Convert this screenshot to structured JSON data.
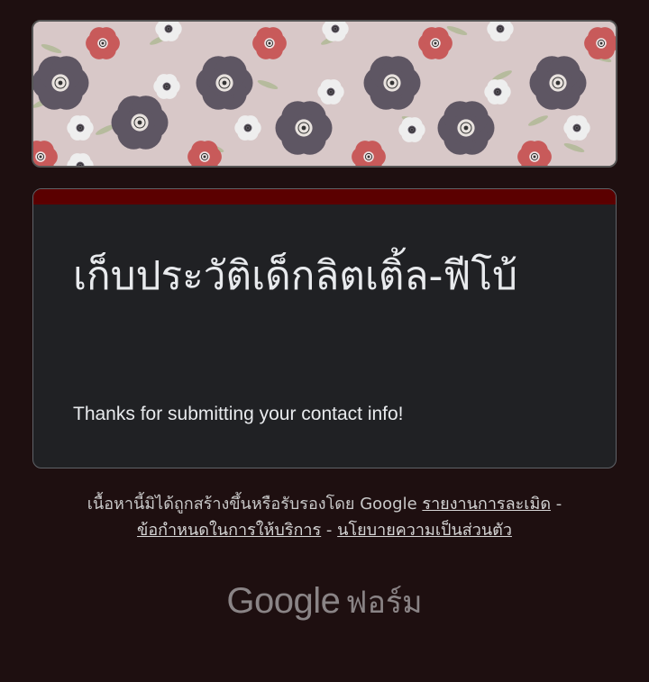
{
  "banner": {
    "background_color": "#d8c8c8",
    "flower_colors": [
      "#5e5663",
      "#c85a5a",
      "#eeeeee"
    ]
  },
  "card": {
    "accent_color": "#5b0000",
    "title": "เก็บประวัติเด็กลิตเติ้ล-ฟีโบ้",
    "confirmation_message": "Thanks for submitting your contact info!"
  },
  "footer": {
    "disclaimer": "เนื้อหานี้มิได้ถูกสร้างขึ้นหรือรับรองโดย Google",
    "report_abuse": "รายงานการละเมิด",
    "separator": "-",
    "terms": "ข้อกำหนดในการให้บริการ",
    "privacy": "นโยบายความเป็นส่วนตัว"
  },
  "brand": {
    "logo_text": "Google",
    "product_name": "ฟอร์ม"
  }
}
